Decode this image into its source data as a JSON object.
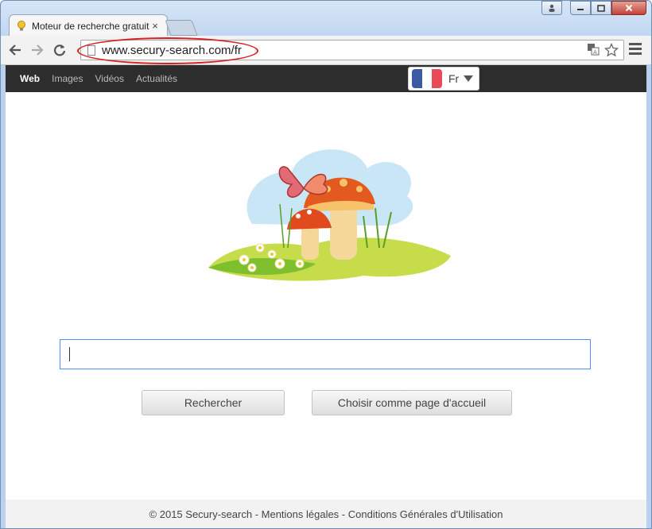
{
  "browser": {
    "tab_title": "Moteur de recherche gratuit",
    "tab_close": "×",
    "url": "www.secury-search.com/fr"
  },
  "nav": {
    "links": [
      "Web",
      "Images",
      "Vidéos",
      "Actualités"
    ],
    "active": "Web"
  },
  "language": {
    "code": "Fr",
    "flag_colors": [
      "#3b5aa6",
      "#ffffff",
      "#e84a5a"
    ]
  },
  "search": {
    "value": "",
    "buttons": {
      "search": "Rechercher",
      "homepage": "Choisir comme page d'accueil"
    }
  },
  "footer": {
    "text": "© 2015 Secury-search - Mentions légales - Conditions Générales d'Utilisation"
  },
  "colors": {
    "accent_border": "#4d90fe",
    "annotation": "#d62020"
  }
}
